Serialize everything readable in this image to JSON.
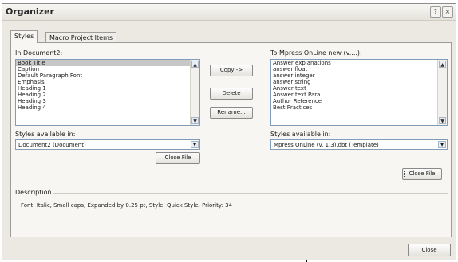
{
  "window": {
    "title": "Organizer"
  },
  "tabs": [
    {
      "label": "Styles",
      "active": true
    },
    {
      "label": "Macro Project Items",
      "active": false
    }
  ],
  "left": {
    "label": "In Document2:",
    "items": [
      "Book Title",
      "Caption",
      "Default Paragraph Font",
      "Emphasis",
      "Heading 1",
      "Heading 2",
      "Heading 3",
      "Heading 4"
    ],
    "selected_index": 0,
    "available_label": "Styles available in:",
    "available_value": "Document2 (Document)",
    "close_button": "Close File"
  },
  "right": {
    "label": "To Mpress OnLine new (v....):",
    "items": [
      "Answer explanations",
      "answer float",
      "answer integer",
      "answer string",
      "Answer text",
      "Answer text Para",
      "Author Reference",
      "Best Practices"
    ],
    "available_label": "Styles available in:",
    "available_value": "Mpress OnLine (v. 1.3).dot (Template)",
    "close_button": "Close File"
  },
  "middle_buttons": {
    "copy": "Copy ->",
    "delete": "Delete",
    "rename": "Rename..."
  },
  "description": {
    "label": "Description",
    "text": "Font: Italic, Small caps, Expanded by 0.25 pt, Style: Quick Style, Priority: 34"
  },
  "footer": {
    "close": "Close"
  }
}
